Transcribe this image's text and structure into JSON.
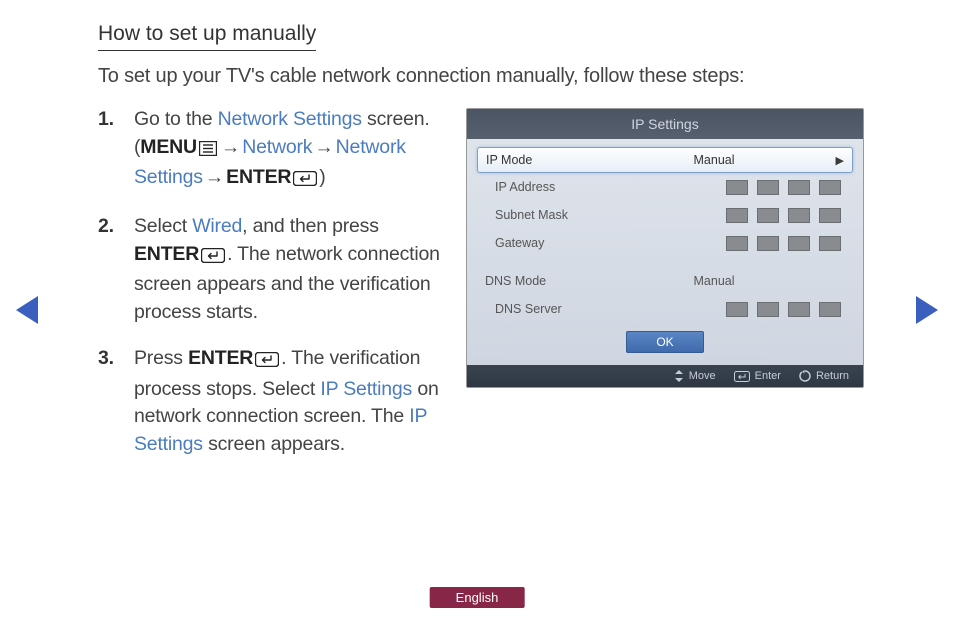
{
  "heading": "How to set up manually",
  "intro": "To set up your TV's cable network connection manually, follow these steps:",
  "steps": {
    "s1": {
      "t1": "Go to the ",
      "link1": "Network Settings",
      "t2": " screen. (",
      "menu": "MENU",
      "arrow1": " → ",
      "link2": "Network",
      "arrow2": " → ",
      "link3": "Network Settings",
      "arrow3": " → ",
      "enter": "ENTER",
      "t3": ")"
    },
    "s2": {
      "t1": "Select ",
      "link1": "Wired",
      "t2": ", and then press ",
      "enter": "ENTER",
      "t3": ". The network connection screen appears and the verification process starts."
    },
    "s3": {
      "t1": "Press ",
      "enter": "ENTER",
      "t2": ". The verification process stops. Select ",
      "link1": "IP Settings",
      "t3": " on network connection screen. The ",
      "link2": "IP Settings",
      "t4": " screen appears."
    }
  },
  "tv": {
    "title": "IP Settings",
    "rows": {
      "ip_mode": {
        "label": "IP Mode",
        "value": "Manual"
      },
      "ip_address": {
        "label": "IP Address"
      },
      "subnet": {
        "label": "Subnet Mask"
      },
      "gateway": {
        "label": "Gateway"
      },
      "dns_mode": {
        "label": "DNS Mode",
        "value": "Manual"
      },
      "dns_server": {
        "label": "DNS Server"
      }
    },
    "ok": "OK",
    "footer": {
      "move": "Move",
      "enter": "Enter",
      "return": "Return"
    }
  },
  "lang": "English"
}
